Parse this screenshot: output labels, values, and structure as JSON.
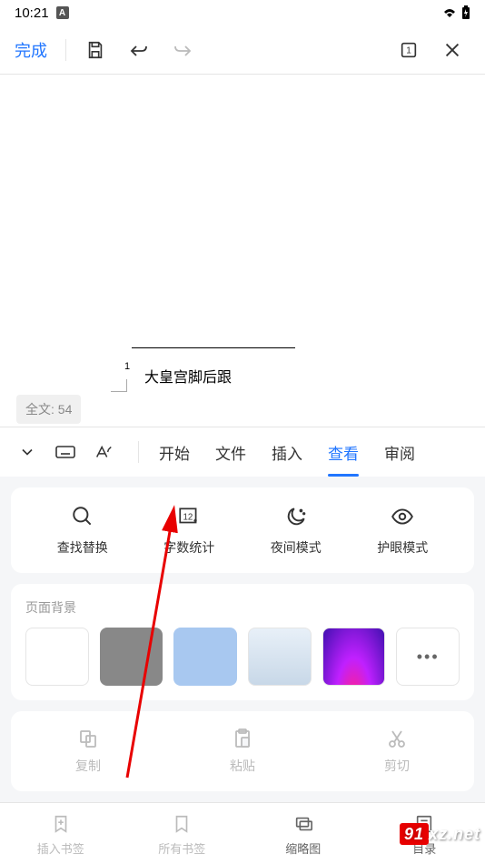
{
  "status": {
    "time": "10:21"
  },
  "toolbar": {
    "done": "完成"
  },
  "document": {
    "text": "大皇宫脚后跟",
    "footnote": "1",
    "wordcount": "全文: 54"
  },
  "tabs": {
    "start": "开始",
    "file": "文件",
    "insert": "插入",
    "view": "查看",
    "review": "审阅"
  },
  "tools": {
    "find": "查找替换",
    "wordcount": "字数统计",
    "night": "夜间模式",
    "eye": "护眼模式"
  },
  "bg": {
    "label": "页面背景"
  },
  "actions": {
    "copy": "复制",
    "paste": "粘贴",
    "cut": "剪切"
  },
  "nav": {
    "insertbm": "插入书签",
    "allbm": "所有书签",
    "thumb": "缩略图",
    "toc": "目录"
  },
  "watermark": {
    "text": "91xz.net"
  }
}
